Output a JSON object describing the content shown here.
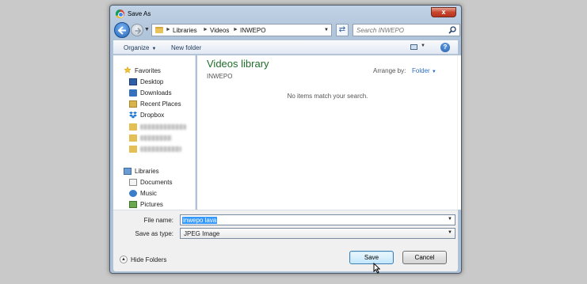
{
  "window": {
    "title": "Save As",
    "close_label": "x"
  },
  "address_bar": {
    "crumbs": [
      "Libraries",
      "Videos",
      "INWEPO"
    ]
  },
  "search": {
    "placeholder": "Search INWEPO"
  },
  "toolbar": {
    "organize_label": "Organize",
    "new_folder_label": "New folder",
    "help_label": "?"
  },
  "nav_pane": {
    "favorites_label": "Favorites",
    "favorites": [
      "Desktop",
      "Downloads",
      "Recent Places",
      "Dropbox"
    ],
    "libraries_label": "Libraries",
    "libraries": [
      "Documents",
      "Music",
      "Pictures"
    ]
  },
  "content": {
    "library_title": "Videos library",
    "library_subtitle": "INWEPO",
    "arrange_by_label": "Arrange by:",
    "arrange_by_value": "Folder",
    "empty_message": "No items match your search."
  },
  "form": {
    "file_name_label": "File name:",
    "file_name_value": "inwepo lava",
    "save_as_type_label": "Save as type:",
    "save_as_type_value": "JPEG Image"
  },
  "footer": {
    "hide_folders_label": "Hide Folders",
    "save_label": "Save",
    "cancel_label": "Cancel"
  },
  "colors": {
    "library_title": "#1e6e2a",
    "selection": "#3399ff",
    "link": "#2d6ec0"
  }
}
